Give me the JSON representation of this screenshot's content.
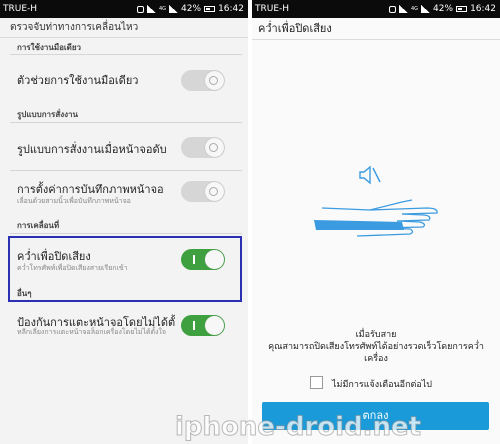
{
  "status_bar_left": {
    "carrier": "TRUE-H",
    "lte": "4G",
    "battery": "42%",
    "time": "16:42"
  },
  "status_bar_right": {
    "carrier": "TRUE-H",
    "lte": "4G",
    "battery": "42%",
    "time": "16:42"
  },
  "settings": {
    "title": "ตรวจจับท่าทางการเคลื่อนไหว",
    "section_onehand": "การใช้งานมือเดียว",
    "row_onehand": {
      "title": "ตัวช่วยการใช้งานมือเดียว",
      "state": "off"
    },
    "section_operation": "รูปแบบการสั่งงาน",
    "row_screenoff": {
      "title": "รูปแบบการสั่งงานเมื่อหน้าจอดับ",
      "state": "off"
    },
    "row_screenshot": {
      "title": "การตั้งค่าการบันทึกภาพหน้าจอ",
      "subtitle": "เลื่อนด้วยสามนิ้วเพื่อบันทึกภาพหน้าจอ",
      "state": "off"
    },
    "section_motion": "การเคลื่อนที่",
    "row_flipmute": {
      "title": "คว่ำเพื่อปิดเสียง",
      "subtitle": "คว่ำโทรศัพท์เพื่อปิดเสียงสายเรียกเข้า",
      "state": "on"
    },
    "section_other": "อื่นๆ",
    "row_prevent": {
      "title": "ป้องกันการแตะหน้าจอโดยไม่ได้ตั้งใจ",
      "subtitle": "หลีกเลี่ยงการแตะหน้าจอล็อกเครื่องโดยไม่ได้ตั้งใจ",
      "state": "on"
    }
  },
  "dialog": {
    "title": "คว่ำเพื่อปิดเสียง",
    "illustration_icon": "speaker-muted-icon",
    "message_line1": "เมื่อรับสาย",
    "message_line2": "คุณสามารถปิดเสียงโทรศัพท์ได้อย่างรวดเร็วโดยการคว่ำเครื่อง",
    "checkbox_label": "ไม่มีการแจ้งเตือนอีกต่อไป",
    "ok_button": "ตกลง"
  },
  "watermark": "iphone-droid.net",
  "colors": {
    "accent": "#1a9ad9",
    "toggle_on": "#3ea03e",
    "highlight": "#2b2fb3",
    "illustration_blue": "#3b9be0"
  }
}
